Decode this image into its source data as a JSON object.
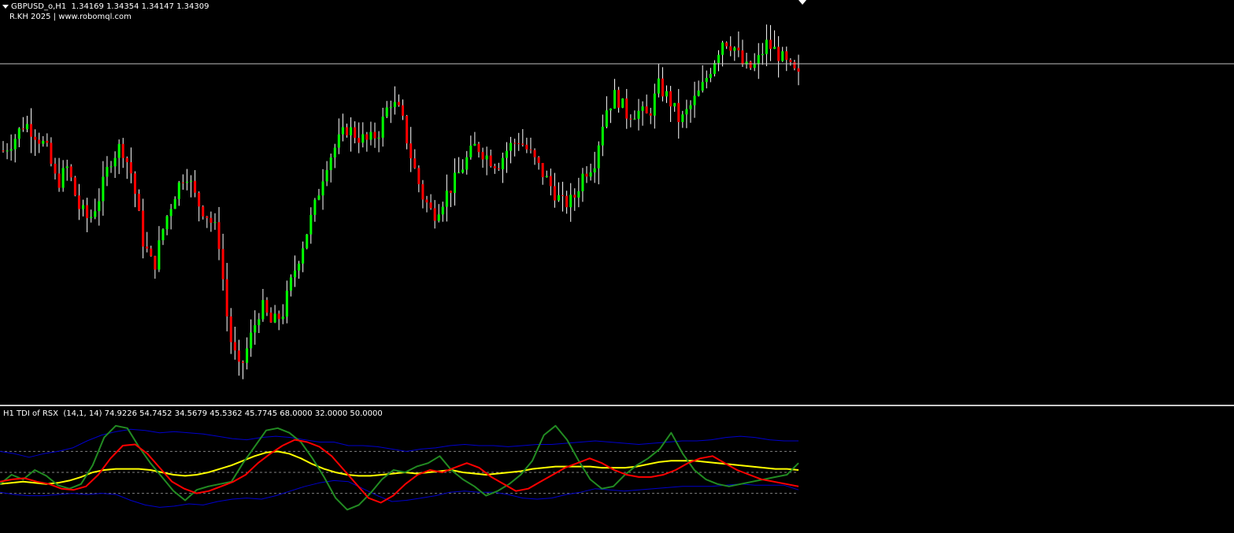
{
  "chart": {
    "symbol_info": "GBPUSD_o,H1  1.34169 1.34354 1.34147 1.34309",
    "watermark": "R.KH 2025 | www.robomql.com",
    "colors": {
      "background": "#000000",
      "bull": "#00ff00",
      "bear": "#ff0000",
      "wick": "#ffffff",
      "bid_line": "#c0c0c0"
    }
  },
  "indicator": {
    "title": "H1 TDI of RSX  (14,1, 14) 74.9226 54.7452 34.5679 45.5362 45.7745 68.0000 32.0000 50.0000",
    "levels": [
      68,
      32,
      50
    ],
    "colors": {
      "upper": "#0000cd",
      "lower": "#0000cd",
      "signal": "#ffff00",
      "rsi": "#228b22",
      "fast": "#ff0000",
      "level": "#808080"
    }
  },
  "chart_data": {
    "type": "line",
    "series": [
      {
        "key": "price_close",
        "closes": [
          1.3418,
          1.3422,
          1.3428,
          1.3424,
          1.3419,
          1.3406,
          1.3412,
          1.3398,
          1.3393,
          1.3402,
          1.3415,
          1.342,
          1.3409,
          1.3386,
          1.3376,
          1.3392,
          1.3403,
          1.3411,
          1.34,
          1.3395,
          1.3388,
          1.3353,
          1.3339,
          1.3351,
          1.3363,
          1.3356,
          1.336,
          1.3374,
          1.3386,
          1.3398,
          1.3413,
          1.342,
          1.3426,
          1.3423,
          1.3421,
          1.3425,
          1.3436,
          1.3431,
          1.3415,
          1.3402,
          1.3395,
          1.3401,
          1.3407,
          1.3414,
          1.342,
          1.3416,
          1.3413,
          1.3419,
          1.3422,
          1.3417,
          1.3411,
          1.3405,
          1.3399,
          1.34,
          1.341,
          1.3414,
          1.3432,
          1.3438,
          1.3431,
          1.3432,
          1.343,
          1.3441,
          1.3436,
          1.3428,
          1.3434,
          1.344,
          1.3449,
          1.3458,
          1.3455,
          1.3447,
          1.3448,
          1.3456,
          1.3453,
          1.3448,
          1.3444
        ]
      },
      {
        "key": "upper",
        "values": [
          68,
          66,
          63,
          66,
          68,
          71,
          77,
          82,
          85,
          87,
          86,
          84,
          85,
          84,
          83,
          81,
          79,
          78,
          80,
          81,
          80,
          78,
          76,
          76,
          73,
          73,
          72,
          70,
          68,
          70,
          71,
          73,
          74,
          73,
          73,
          72,
          73,
          74,
          74,
          75,
          76,
          77,
          76,
          75,
          74,
          75,
          76,
          77,
          77,
          78,
          80,
          81,
          80,
          78,
          77,
          77
        ]
      },
      {
        "key": "lower",
        "values": [
          33,
          31,
          30,
          30,
          31,
          32,
          31,
          32,
          31,
          26,
          22,
          20,
          21,
          23,
          22,
          25,
          27,
          28,
          27,
          30,
          34,
          38,
          41,
          43,
          42,
          36,
          30,
          25,
          26,
          28,
          30,
          33,
          34,
          33,
          33,
          31,
          28,
          27,
          28,
          31,
          33,
          36,
          35,
          34,
          35,
          36,
          37,
          38,
          38,
          38,
          39,
          40,
          39,
          39,
          39,
          35
        ]
      },
      {
        "key": "rsi",
        "values": [
          40,
          48,
          44,
          52,
          47,
          39,
          36,
          40,
          56,
          80,
          90,
          88,
          72,
          58,
          46,
          34,
          26,
          35,
          38,
          40,
          42,
          58,
          72,
          86,
          88,
          84,
          76,
          62,
          46,
          28,
          18,
          22,
          32,
          44,
          52,
          50,
          55,
          58,
          64,
          52,
          44,
          38,
          30,
          34,
          40,
          48,
          60,
          82,
          90,
          78,
          60,
          44,
          36,
          38,
          48,
          56,
          62,
          70,
          84,
          66,
          52,
          44,
          40,
          38,
          40,
          42,
          44,
          46,
          48,
          58
        ]
      },
      {
        "key": "fast",
        "values": [
          42,
          44,
          45,
          42,
          40,
          36,
          35,
          38,
          48,
          62,
          73,
          74,
          66,
          54,
          42,
          36,
          32,
          34,
          38,
          42,
          48,
          58,
          66,
          73,
          78,
          76,
          72,
          64,
          52,
          40,
          28,
          24,
          30,
          40,
          48,
          52,
          50,
          54,
          58,
          54,
          46,
          40,
          34,
          36,
          42,
          48,
          54,
          58,
          62,
          58,
          52,
          48,
          46,
          46,
          48,
          52,
          58,
          62,
          64,
          58,
          52,
          48,
          44,
          42,
          40,
          38
        ]
      },
      {
        "key": "signal",
        "values": [
          40,
          41,
          42,
          41,
          40,
          41,
          43,
          46,
          50,
          52,
          53,
          53,
          53,
          52,
          50,
          48,
          47,
          48,
          50,
          53,
          56,
          60,
          64,
          67,
          68,
          66,
          62,
          57,
          53,
          50,
          48,
          47,
          47,
          48,
          49,
          50,
          49,
          50,
          51,
          52,
          50,
          49,
          48,
          49,
          50,
          51,
          53,
          54,
          55,
          55,
          55,
          55,
          54,
          54,
          54,
          55,
          57,
          59,
          60,
          60,
          60,
          59,
          58,
          57,
          56,
          55,
          54,
          53,
          53,
          52
        ]
      }
    ]
  }
}
